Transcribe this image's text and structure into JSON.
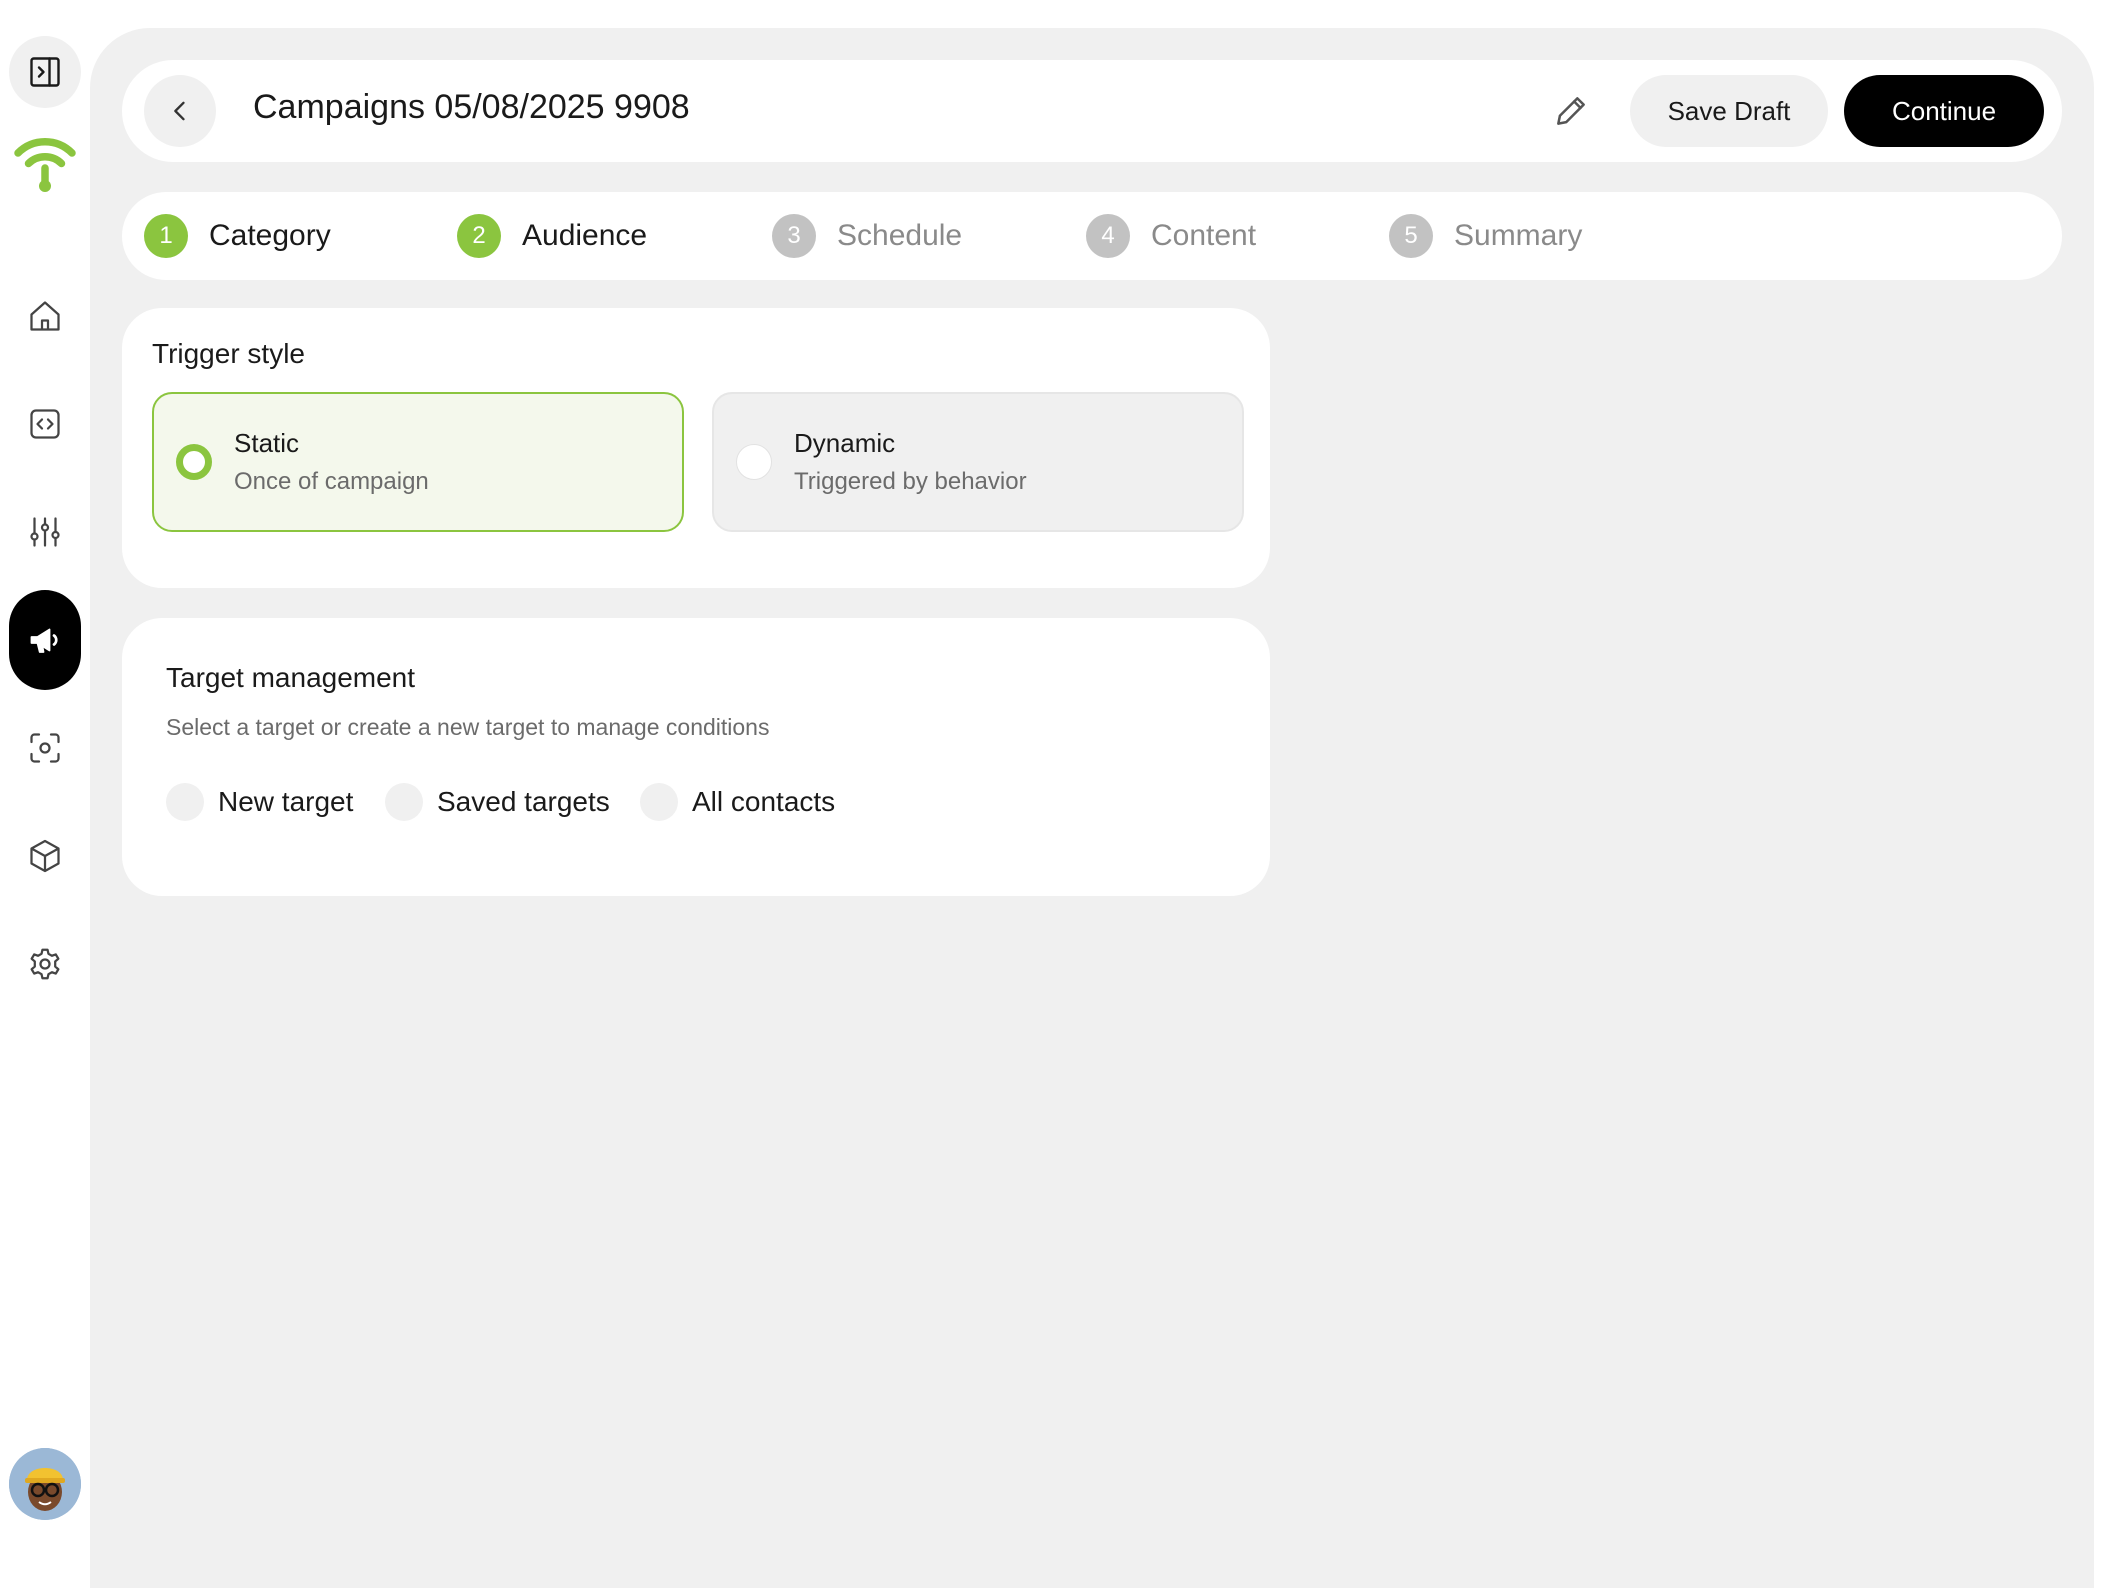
{
  "header": {
    "title": "Campaigns 05/08/2025 9908",
    "save_label": "Save Draft",
    "continue_label": "Continue"
  },
  "steps": [
    {
      "num": "1",
      "label": "Category",
      "state": "done"
    },
    {
      "num": "2",
      "label": "Audience",
      "state": "done"
    },
    {
      "num": "3",
      "label": "Schedule",
      "state": "todo"
    },
    {
      "num": "4",
      "label": "Content",
      "state": "todo"
    },
    {
      "num": "5",
      "label": "Summary",
      "state": "todo"
    }
  ],
  "trigger": {
    "title": "Trigger style",
    "options": [
      {
        "title": "Static",
        "subtitle": "Once of campaign",
        "selected": true
      },
      {
        "title": "Dynamic",
        "subtitle": "Triggered by behavior",
        "selected": false
      }
    ]
  },
  "target": {
    "title": "Target management",
    "subtitle": "Select a target or create a new target to manage conditions",
    "options": [
      {
        "label": "New target"
      },
      {
        "label": "Saved targets"
      },
      {
        "label": "All contacts"
      }
    ]
  },
  "sidebar": {
    "icons": [
      "collapse-icon",
      "wifi-logo-icon",
      "home-icon",
      "code-icon",
      "sliders-icon",
      "megaphone-icon",
      "scan-icon",
      "box-icon",
      "gear-icon"
    ]
  },
  "colors": {
    "accent": "#8bc53f",
    "primary_button": "#000000",
    "background": "#f0f0f0"
  }
}
